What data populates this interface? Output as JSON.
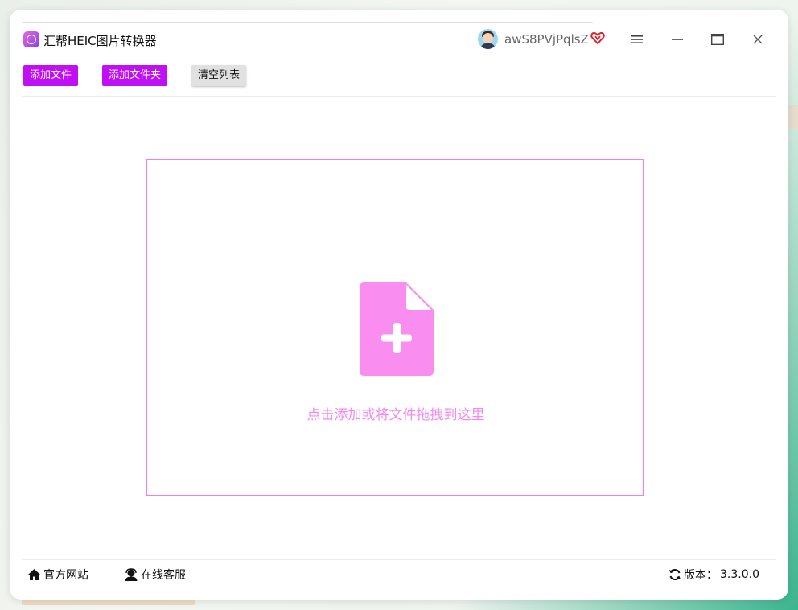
{
  "app": {
    "title": "汇帮HEIC图片转换器"
  },
  "user": {
    "name": "awS8PVjPqlsZ"
  },
  "toolbar": {
    "add_file": "添加文件",
    "add_folder": "添加文件夹",
    "clear_list": "清空列表"
  },
  "dropzone": {
    "hint": "点击添加或将文件拖拽到这里"
  },
  "footer": {
    "website": "官方网站",
    "support": "在线客服",
    "version_label": "版本：",
    "version_number": "3.3.0.0"
  },
  "colors": {
    "accent": "#c00ef5",
    "drop_border": "#f07ef0",
    "drop_icon": "#f98df0",
    "drop_text": "#f28af0",
    "vip": "#e0202a"
  },
  "icons": {
    "app": "app-logo-icon",
    "vip": "vip-heart-icon",
    "menu": "menu-icon",
    "minimize": "minimize-icon",
    "maximize": "maximize-icon",
    "close": "close-icon",
    "file_add": "file-add-icon",
    "home": "home-icon",
    "support": "support-agent-icon",
    "refresh": "refresh-icon"
  }
}
